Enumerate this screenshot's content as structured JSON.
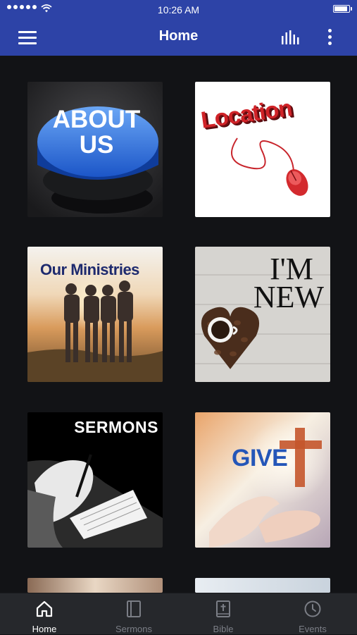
{
  "status_bar": {
    "time": "10:26 AM"
  },
  "app_bar": {
    "title": "Home"
  },
  "tiles": [
    {
      "label_line1": "ABOUT",
      "label_line2": "US"
    },
    {
      "label": "Location"
    },
    {
      "label": "Our Ministries"
    },
    {
      "label_line1": "I'M",
      "label_line2": "NEW"
    },
    {
      "label": "SERMONS"
    },
    {
      "label": "GIVE"
    }
  ],
  "tab_bar": {
    "items": [
      {
        "label": "Home",
        "icon": "home-icon",
        "active": true
      },
      {
        "label": "Sermons",
        "icon": "book-icon",
        "active": false
      },
      {
        "label": "Bible",
        "icon": "bible-icon",
        "active": false
      },
      {
        "label": "Events",
        "icon": "clock-icon",
        "active": false
      }
    ]
  },
  "colors": {
    "app_bar": "#2d43a7",
    "background": "#121316",
    "tab_bar": "#26282c",
    "tab_active": "#ffffff",
    "tab_inactive": "#7b7e86"
  }
}
